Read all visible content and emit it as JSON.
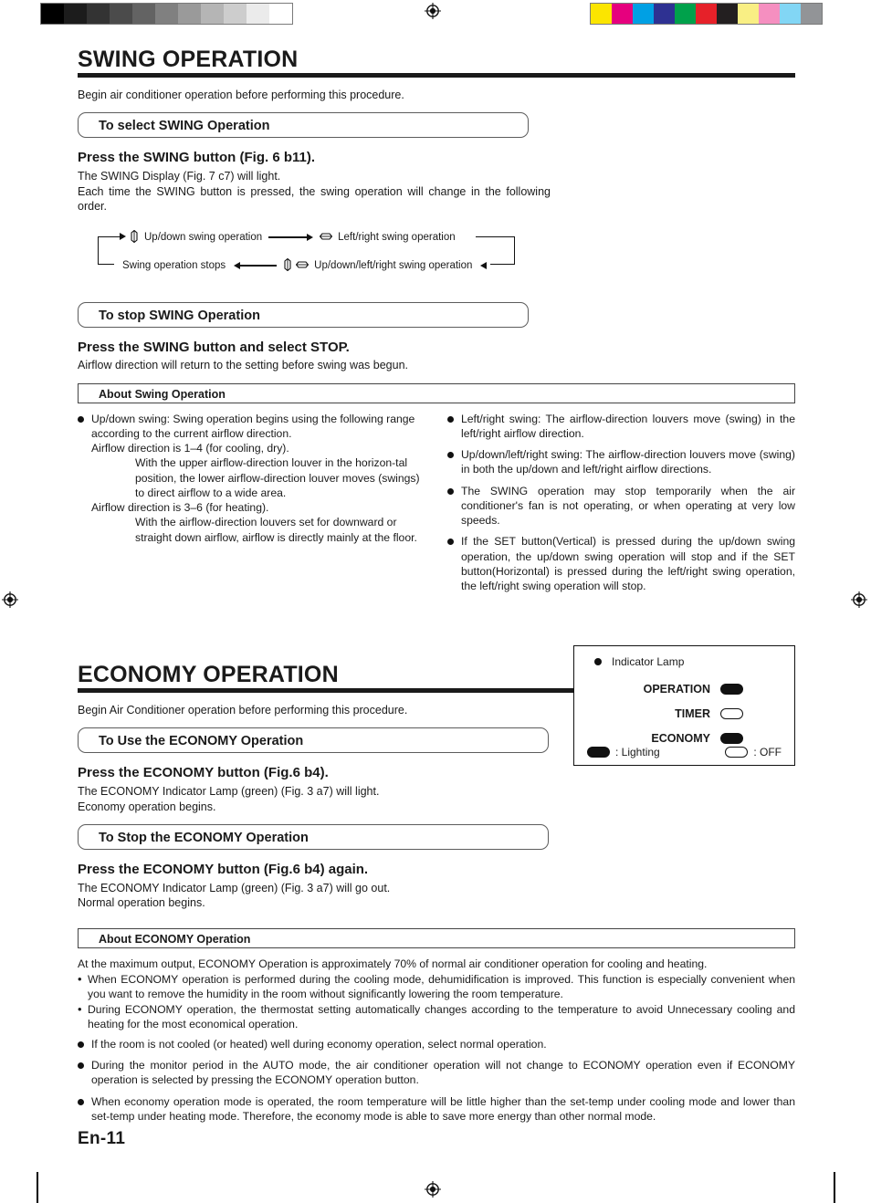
{
  "calibration": {
    "gray_ramp": [
      "#000000",
      "#1c1c1c",
      "#333333",
      "#4b4b4b",
      "#636363",
      "#808080",
      "#9a9a9a",
      "#b5b5b5",
      "#cdcdcd",
      "#ebebeb",
      "#ffffff"
    ],
    "color_ramp": [
      "#fbe500",
      "#e6007e",
      "#00a0e4",
      "#2e3192",
      "#00a14b",
      "#e62129",
      "#231f20",
      "#f9ef84",
      "#f58fc0",
      "#82d6f5",
      "#929497"
    ]
  },
  "swing": {
    "title": "SWING OPERATION",
    "intro": "Begin air conditioner operation before performing this procedure.",
    "select_pill": "To select SWING Operation",
    "select_step": "Press the SWING button (Fig. 6 b11).",
    "select_body_line1": "The SWING Display (Fig. 7 c7) will light.",
    "select_body_line2": "Each time the SWING button is pressed, the swing operation will change in the following order.",
    "cycle": {
      "step1": "Up/down swing operation",
      "step2": "Left/right swing operation",
      "step3": "Up/down/left/right swing operation",
      "step4": "Swing operation stops"
    },
    "stop_pill": "To stop SWING Operation",
    "stop_step": "Press the SWING button and select STOP.",
    "stop_body": "Airflow direction will return to the setting before swing was begun.",
    "about_bar": "About Swing Operation",
    "about_left": [
      {
        "lead": "Up/down swing: Swing operation begins using the following range according to the current airflow direction.",
        "lines": [
          {
            "type": "plain",
            "text": "Airflow direction is 1–4 (for cooling, dry)."
          },
          {
            "type": "indent",
            "text": "With the upper airflow-direction louver in the horizon-tal position, the lower airflow-direction louver moves (swings) to direct airflow to a wide area."
          },
          {
            "type": "plain",
            "text": "Airflow direction is 3–6 (for heating)."
          },
          {
            "type": "indent",
            "text": "With the airflow-direction louvers set for downward or straight down airflow, airflow is directly mainly at the floor."
          }
        ]
      }
    ],
    "about_right": [
      "Left/right swing: The airflow-direction louvers move (swing) in the left/right airflow direction.",
      "Up/down/left/right swing: The airflow-direction louvers move (swing) in both the up/down and left/right airflow directions.",
      "The SWING operation may stop temporarily when the air conditioner's fan is not operating, or when operating at very low speeds.",
      "If the SET button(Vertical) is pressed during the up/down swing operation, the up/down swing operation will stop and if the SET button(Horizontal) is pressed during the left/right swing operation, the left/right swing operation will stop."
    ]
  },
  "economy": {
    "title": "ECONOMY OPERATION",
    "intro": "Begin Air Conditioner operation before performing this procedure.",
    "use_pill": "To Use the ECONOMY Operation",
    "use_step": "Press the ECONOMY button (Fig.6 b4).",
    "use_body_line1": "The ECONOMY Indicator Lamp (green) (Fig. 3 a7) will light.",
    "use_body_line2": "Economy operation begins.",
    "stop_pill": "To Stop the ECONOMY Operation",
    "stop_step": "Press the ECONOMY button (Fig.6 b4) again.",
    "stop_body_line1": "The ECONOMY Indicator Lamp (green) (Fig. 3 a7) will go out.",
    "stop_body_line2": "Normal operation begins.",
    "about_bar": "About ECONOMY Operation",
    "about_lead": "At the maximum output, ECONOMY Operation is approximately 70% of normal air conditioner operation for cooling and heating.",
    "about_dashes": [
      "When ECONOMY operation is performed during the cooling mode, dehumidification is improved. This function is especially convenient when you want to remove the humidity in the room without significantly lowering the room temperature.",
      "During ECONOMY operation, the thermostat setting automatically changes according to the temperature to avoid Unnecessary cooling and heating for the most economical operation."
    ],
    "about_bullets": [
      "If the room is not cooled (or heated) well during economy operation, select normal operation.",
      "During the monitor period in the AUTO mode, the air conditioner operation will not change to ECONOMY operation even if ECONOMY operation is selected by pressing the ECONOMY operation button.",
      "When economy operation mode is operated, the room temperature will be little higher than the set-temp under cooling mode and lower than set-temp under heating mode. Therefore, the economy mode is able to save more energy than other normal mode."
    ]
  },
  "lamp_panel": {
    "heading": "Indicator Lamp",
    "rows": [
      {
        "label": "OPERATION",
        "state": "on"
      },
      {
        "label": "TIMER",
        "state": "off"
      },
      {
        "label": "ECONOMY",
        "state": "on"
      }
    ],
    "legend_on": ": Lighting",
    "legend_off": ": OFF"
  },
  "footer": {
    "page": "En-11"
  }
}
